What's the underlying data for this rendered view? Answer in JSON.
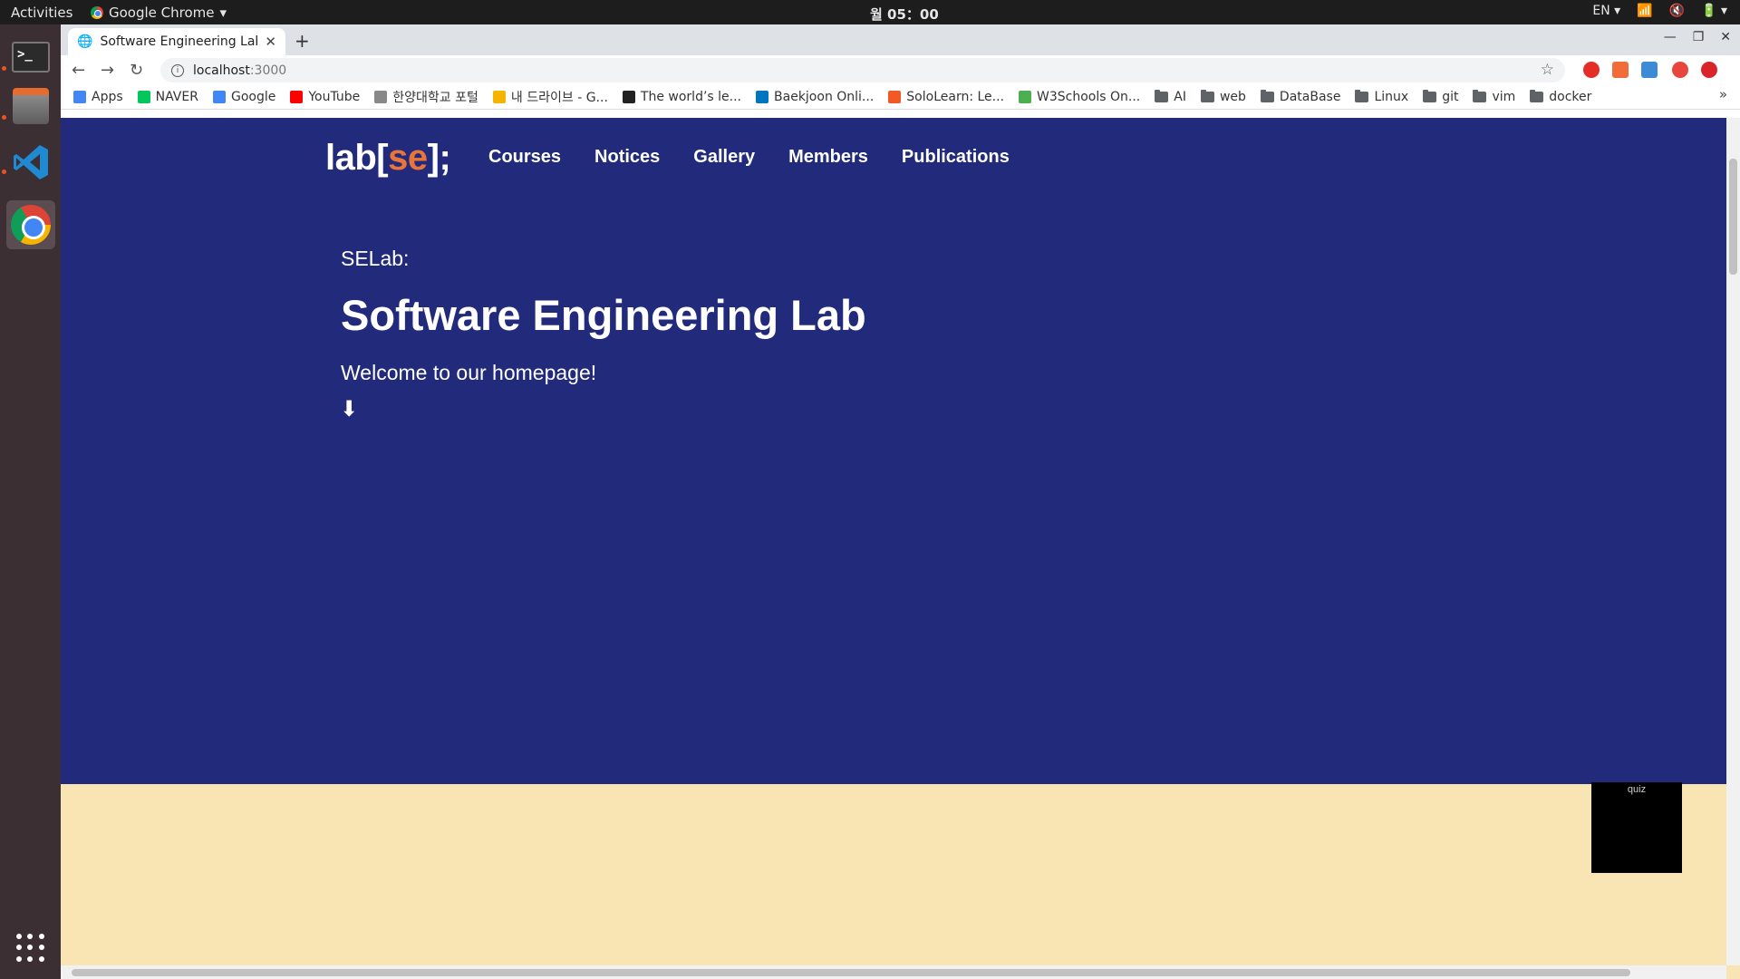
{
  "topbar": {
    "activities": "Activities",
    "app_name": "Google Chrome",
    "clock": "월 05：00",
    "lang": "EN"
  },
  "dock": {
    "apps": [
      "terminal",
      "files",
      "vscode",
      "chrome"
    ]
  },
  "browser": {
    "tab_title": "Software Engineering Lab",
    "url_host": "localhost",
    "url_port": ":3000",
    "bookmarks": [
      {
        "label": "Apps",
        "icon": "apps-grid-icon",
        "color": "#4285f4"
      },
      {
        "label": "NAVER",
        "icon": "naver-icon",
        "color": "#03c75a"
      },
      {
        "label": "Google",
        "icon": "google-icon",
        "color": "#4285f4"
      },
      {
        "label": "YouTube",
        "icon": "youtube-icon",
        "color": "#ff0000"
      },
      {
        "label": "한양대학교 포털",
        "icon": "hanyang-icon",
        "color": "#888888"
      },
      {
        "label": "내 드라이브 - G...",
        "icon": "drive-icon",
        "color": "#f4b400"
      },
      {
        "label": "The world’s le...",
        "icon": "github-icon",
        "color": "#222222"
      },
      {
        "label": "Baekjoon Onli...",
        "icon": "baekjoon-icon",
        "color": "#0076c0"
      },
      {
        "label": "SoloLearn: Le...",
        "icon": "sololearn-icon",
        "color": "#f15a24"
      },
      {
        "label": "W3Schools On...",
        "icon": "w3schools-icon",
        "color": "#4caf50"
      },
      {
        "label": "AI",
        "icon": "folder-icon"
      },
      {
        "label": "web",
        "icon": "folder-icon"
      },
      {
        "label": "DataBase",
        "icon": "folder-icon"
      },
      {
        "label": "Linux",
        "icon": "folder-icon"
      },
      {
        "label": "git",
        "icon": "folder-icon"
      },
      {
        "label": "vim",
        "icon": "folder-icon"
      },
      {
        "label": "docker",
        "icon": "folder-icon"
      }
    ],
    "more": "»"
  },
  "page": {
    "logo_pre": "lab[",
    "logo_se": "se",
    "logo_post": "];",
    "nav": [
      "Courses",
      "Notices",
      "Gallery",
      "Members",
      "Publications"
    ],
    "subtitle": "SELab:",
    "title": "Software Engineering Lab",
    "welcome": "Welcome to our homepage!",
    "arrow": "⬇",
    "quiz_label": "quiz",
    "colors": {
      "hero_bg": "#222a7b",
      "accent": "#e8753b",
      "section_bg": "#f9e4b3"
    }
  }
}
